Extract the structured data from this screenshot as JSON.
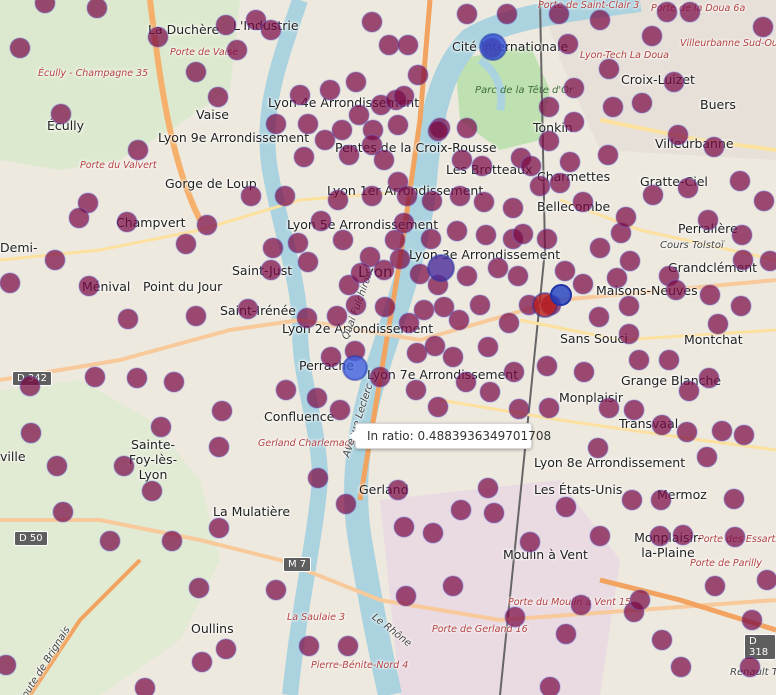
{
  "map": {
    "labels": [
      {
        "text": "La Duchère",
        "cls": ""
      },
      {
        "text": "L'Industrie",
        "cls": ""
      },
      {
        "text": "Cité Internationale",
        "cls": ""
      },
      {
        "text": "Lyon-Tech La Doua",
        "cls": "small"
      },
      {
        "text": "Porte de la Doua 6a",
        "cls": "small"
      },
      {
        "text": "Villeurbanne Sud-Ouest",
        "cls": "small"
      },
      {
        "text": "Porte de Saint-Clair 3",
        "cls": "small"
      },
      {
        "text": "Porte de Vaise",
        "cls": "small"
      },
      {
        "text": "Écully - Champagne 35",
        "cls": "small"
      },
      {
        "text": "Écully",
        "cls": ""
      },
      {
        "text": "Vaise",
        "cls": ""
      },
      {
        "text": "Lyon 4e Arrondissement",
        "cls": ""
      },
      {
        "text": "Parc de la Tête d'Or",
        "cls": "park"
      },
      {
        "text": "Croix-Luizet",
        "cls": ""
      },
      {
        "text": "Buers",
        "cls": ""
      },
      {
        "text": "Lyon 9e Arrondissement",
        "cls": ""
      },
      {
        "text": "Tonkin",
        "cls": ""
      },
      {
        "text": "Villeurbanne",
        "cls": ""
      },
      {
        "text": "Porte du Valvert",
        "cls": "small"
      },
      {
        "text": "Pentes de la Croix-Rousse",
        "cls": ""
      },
      {
        "text": "Les Brotteaux",
        "cls": ""
      },
      {
        "text": "Charmettes",
        "cls": ""
      },
      {
        "text": "Gratte-Ciel",
        "cls": ""
      },
      {
        "text": "Gorge de Loup",
        "cls": ""
      },
      {
        "text": "Lyon 1er Arrondissement",
        "cls": ""
      },
      {
        "text": "Bellecombe",
        "cls": ""
      },
      {
        "text": "Champvert",
        "cls": ""
      },
      {
        "text": "Lyon 5e Arrondissement",
        "cls": ""
      },
      {
        "text": "Perralière",
        "cls": ""
      },
      {
        "text": "Demi-",
        "cls": ""
      },
      {
        "text": "Lyon 3e Arrondissement",
        "cls": ""
      },
      {
        "text": "Cours Tolstoï",
        "cls": "road"
      },
      {
        "text": "Grandclément",
        "cls": ""
      },
      {
        "text": "Saint-Just",
        "cls": ""
      },
      {
        "text": "Lyon",
        "cls": ""
      },
      {
        "text": "Ménival",
        "cls": ""
      },
      {
        "text": "Point du Jour",
        "cls": ""
      },
      {
        "text": "Maisons-Neuves",
        "cls": ""
      },
      {
        "text": "Saint-Irénée",
        "cls": ""
      },
      {
        "text": "Lyon 2e Arrondissement",
        "cls": ""
      },
      {
        "text": "Montchat",
        "cls": ""
      },
      {
        "text": "Sans Souci",
        "cls": ""
      },
      {
        "text": "Perrache",
        "cls": ""
      },
      {
        "text": "Lyon 7e Arrondissement",
        "cls": ""
      },
      {
        "text": "Grange Blanche",
        "cls": ""
      },
      {
        "text": "Monplaisir",
        "cls": ""
      },
      {
        "text": "Confluence",
        "cls": ""
      },
      {
        "text": "Transvaal",
        "cls": ""
      },
      {
        "text": "Gerland Charlemagne",
        "cls": "small"
      },
      {
        "text": "Sainte-Foy-lès-Lyon",
        "cls": ""
      },
      {
        "text": "Lyon 8e Arrondissement",
        "cls": ""
      },
      {
        "text": "ville",
        "cls": ""
      },
      {
        "text": "Les États-Unis",
        "cls": ""
      },
      {
        "text": "Gerland",
        "cls": ""
      },
      {
        "text": "Mermoz",
        "cls": ""
      },
      {
        "text": "Porte des Essarts",
        "cls": "small"
      },
      {
        "text": "La Mulatière",
        "cls": ""
      },
      {
        "text": "Moulin à Vent",
        "cls": ""
      },
      {
        "text": "Monplaisir-la-Plaine",
        "cls": ""
      },
      {
        "text": "Porte de Parilly",
        "cls": "small"
      },
      {
        "text": "Porte du Moulin à Vent 15",
        "cls": "small"
      },
      {
        "text": "Oullins",
        "cls": ""
      },
      {
        "text": "La Saulaie 3",
        "cls": "small"
      },
      {
        "text": "Porte de Gerland 16",
        "cls": "small"
      },
      {
        "text": "Pierre-Bénite-Nord 4",
        "cls": "small"
      },
      {
        "text": "Renault Trucks",
        "cls": "road"
      },
      {
        "text": "Quai Fulchiron",
        "cls": "road"
      },
      {
        "text": "Avenue Leclerc",
        "cls": "road"
      },
      {
        "text": "Le Rhône",
        "cls": "road"
      },
      {
        "text": "Route de Brignais",
        "cls": "road"
      }
    ],
    "road_shields": [
      "D 342",
      "D 50",
      "M 7",
      "D 318"
    ]
  },
  "markers": {
    "default_color": "#7a0a45",
    "default_stroke": "#6a6fd6",
    "highlighted": [
      {
        "name": "cite-internationale-station",
        "color": "#2f4fd0"
      },
      {
        "name": "perrache-station",
        "color": "#3f5fe0"
      },
      {
        "name": "part-dieu-station",
        "color": "#4a2a9a"
      },
      {
        "name": "tooltip-target-station",
        "color": "#b91c1c"
      }
    ]
  },
  "tooltip": {
    "text": "In ratio: 0.4883936349701708"
  }
}
